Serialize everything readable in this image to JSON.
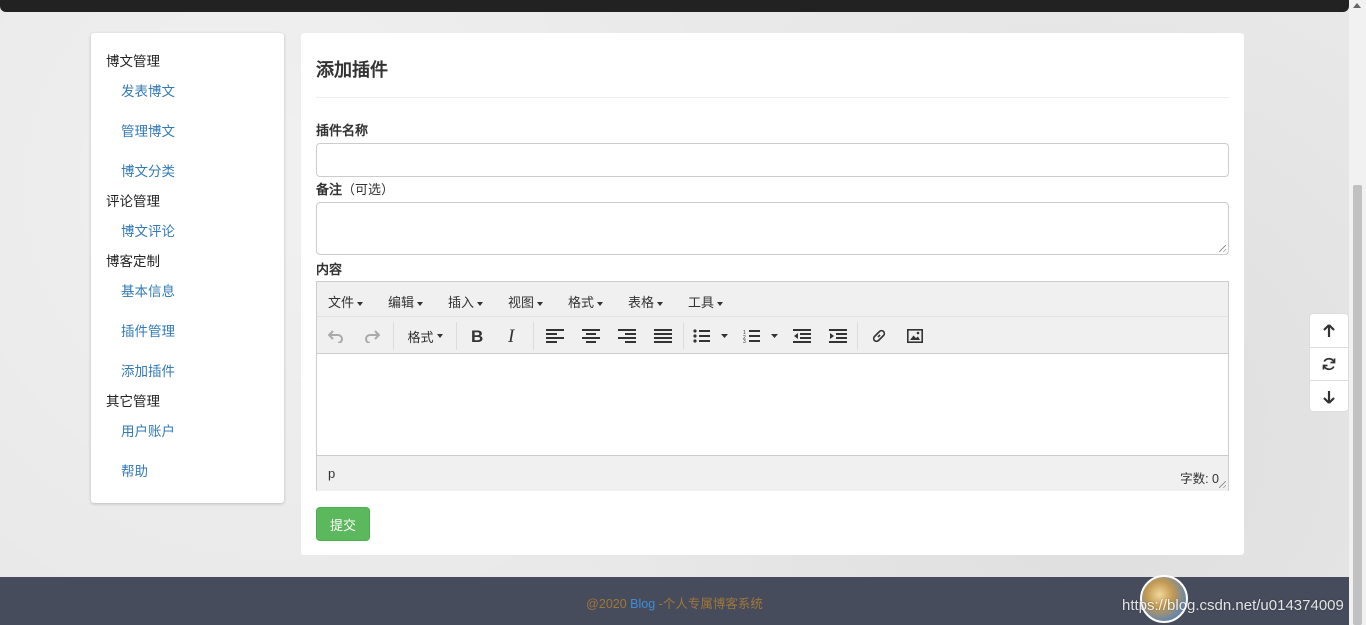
{
  "sidebar": {
    "groups": [
      {
        "label": "博文管理",
        "items": [
          "发表博文",
          "管理博文",
          "博文分类"
        ]
      },
      {
        "label": "评论管理",
        "items": [
          "博文评论"
        ]
      },
      {
        "label": "博客定制",
        "items": [
          "基本信息",
          "插件管理",
          "添加插件"
        ]
      },
      {
        "label": "其它管理",
        "items": [
          "用户账户",
          "帮助"
        ]
      }
    ]
  },
  "page": {
    "title": "添加插件",
    "name_label": "插件名称",
    "name_value": "",
    "note_label": "备注",
    "note_optional": "（可选）",
    "note_value": "",
    "content_label": "内容",
    "submit_label": "提交"
  },
  "editor": {
    "menus": [
      "文件",
      "编辑",
      "插入",
      "视图",
      "格式",
      "表格",
      "工具"
    ],
    "format_dropdown": "格式",
    "path": "p",
    "word_count_label": "字数:",
    "word_count": "0"
  },
  "footer": {
    "prefix": "@2020 ",
    "brand": "Blog",
    "suffix": " -个人专属博客系统"
  },
  "watermark": "https://blog.csdn.net/u014374009"
}
